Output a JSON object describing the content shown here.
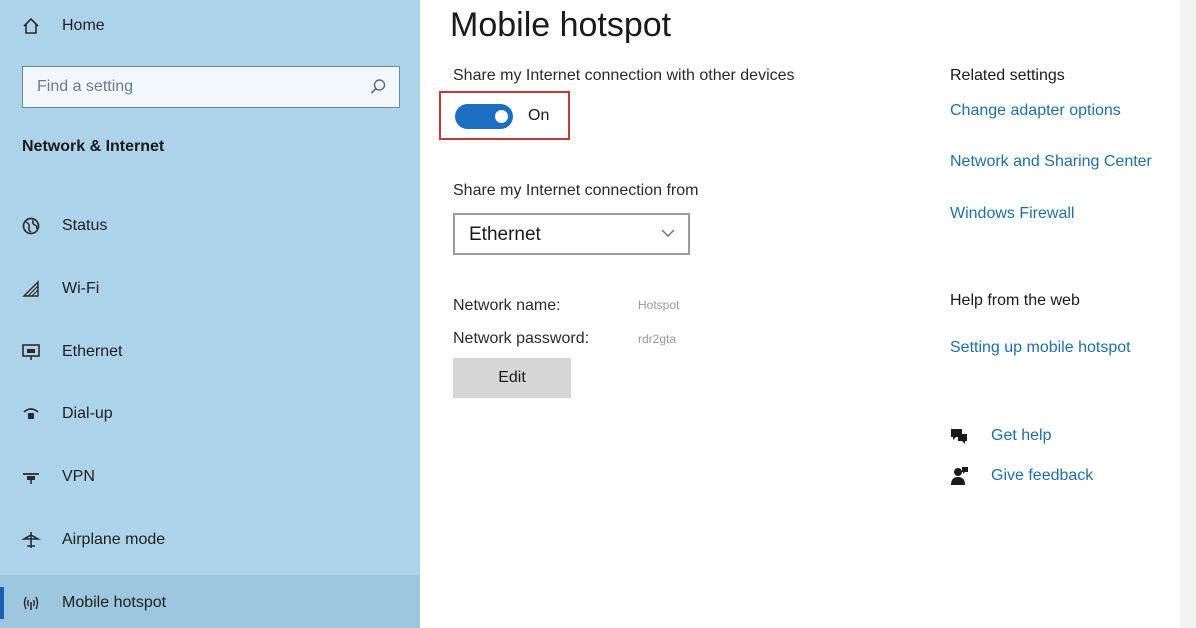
{
  "sidebar": {
    "home_label": "Home",
    "search_placeholder": "Find a setting",
    "section_title": "Network & Internet",
    "items": [
      {
        "label": "Status",
        "icon": "globe-icon"
      },
      {
        "label": "Wi-Fi",
        "icon": "wifi-icon"
      },
      {
        "label": "Ethernet",
        "icon": "ethernet-icon"
      },
      {
        "label": "Dial-up",
        "icon": "dialup-icon"
      },
      {
        "label": "VPN",
        "icon": "vpn-icon"
      },
      {
        "label": "Airplane mode",
        "icon": "airplane-icon"
      },
      {
        "label": "Mobile hotspot",
        "icon": "hotspot-icon",
        "selected": true
      }
    ]
  },
  "main": {
    "title": "Mobile hotspot",
    "share_label": "Share my Internet connection with other devices",
    "toggle_state": "On",
    "share_from_label": "Share my Internet connection from",
    "share_from_value": "Ethernet",
    "network_name_label": "Network name:",
    "network_name_value": "Hotspot",
    "network_password_label": "Network password:",
    "network_password_value": "rdr2gta",
    "edit_label": "Edit"
  },
  "related": {
    "heading": "Related settings",
    "links": [
      "Change adapter options",
      "Network and Sharing Center",
      "Windows Firewall"
    ]
  },
  "help": {
    "heading": "Help from the web",
    "link": "Setting up mobile hotspot",
    "get_help": "Get help",
    "give_feedback": "Give feedback"
  },
  "colors": {
    "sidebar_bg": "#add3ea",
    "accent": "#1b6ec2",
    "link": "#1e6fa8",
    "highlight_border": "#c23b3b"
  }
}
